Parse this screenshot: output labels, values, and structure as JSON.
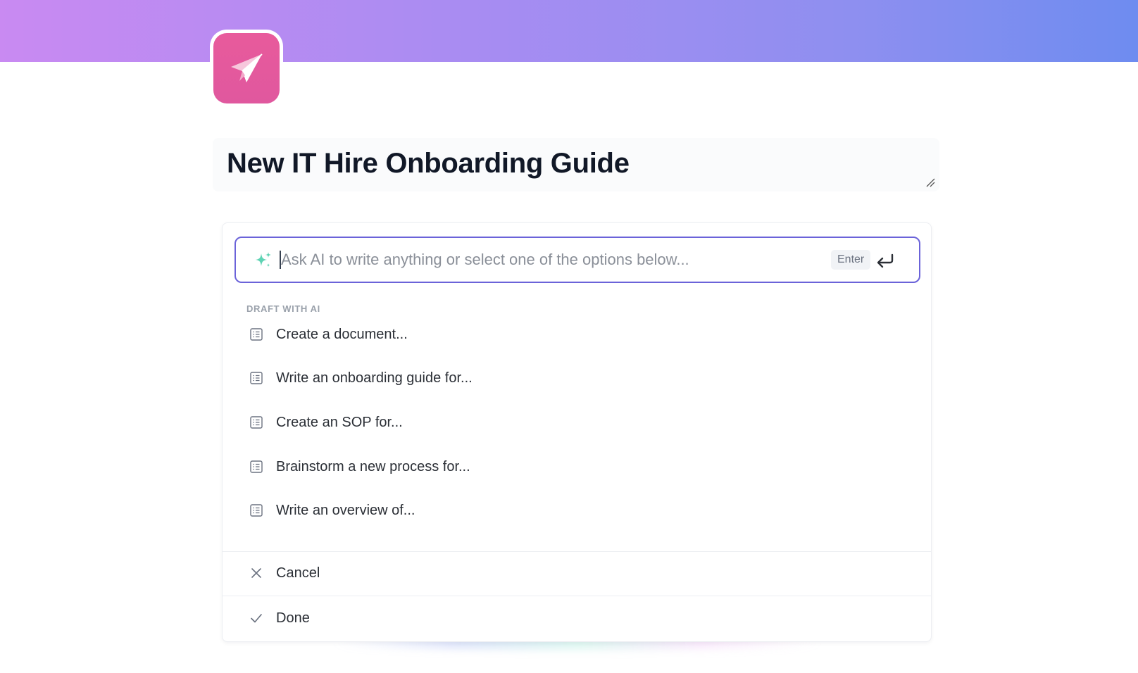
{
  "page": {
    "title": "New IT Hire Onboarding Guide",
    "icon": "paper-plane-icon"
  },
  "colors": {
    "banner_start": "#c98af2",
    "banner_end": "#6e8cf0",
    "icon_bg": "#e85a9c",
    "input_border": "#6b63d9",
    "sparkle": "#5fd3b4"
  },
  "ai": {
    "placeholder": "Ask AI to write anything or select one of the options below...",
    "value": "",
    "enter_label": "Enter",
    "section_label": "DRAFT WITH AI",
    "options": [
      {
        "label": "Create a document...",
        "icon": "document-list-icon"
      },
      {
        "label": "Write an onboarding guide for...",
        "icon": "document-list-icon"
      },
      {
        "label": "Create an SOP for...",
        "icon": "document-list-icon"
      },
      {
        "label": "Brainstorm a new process for...",
        "icon": "document-list-icon"
      },
      {
        "label": "Write an overview of...",
        "icon": "document-list-icon"
      }
    ],
    "cancel_label": "Cancel",
    "done_label": "Done"
  }
}
